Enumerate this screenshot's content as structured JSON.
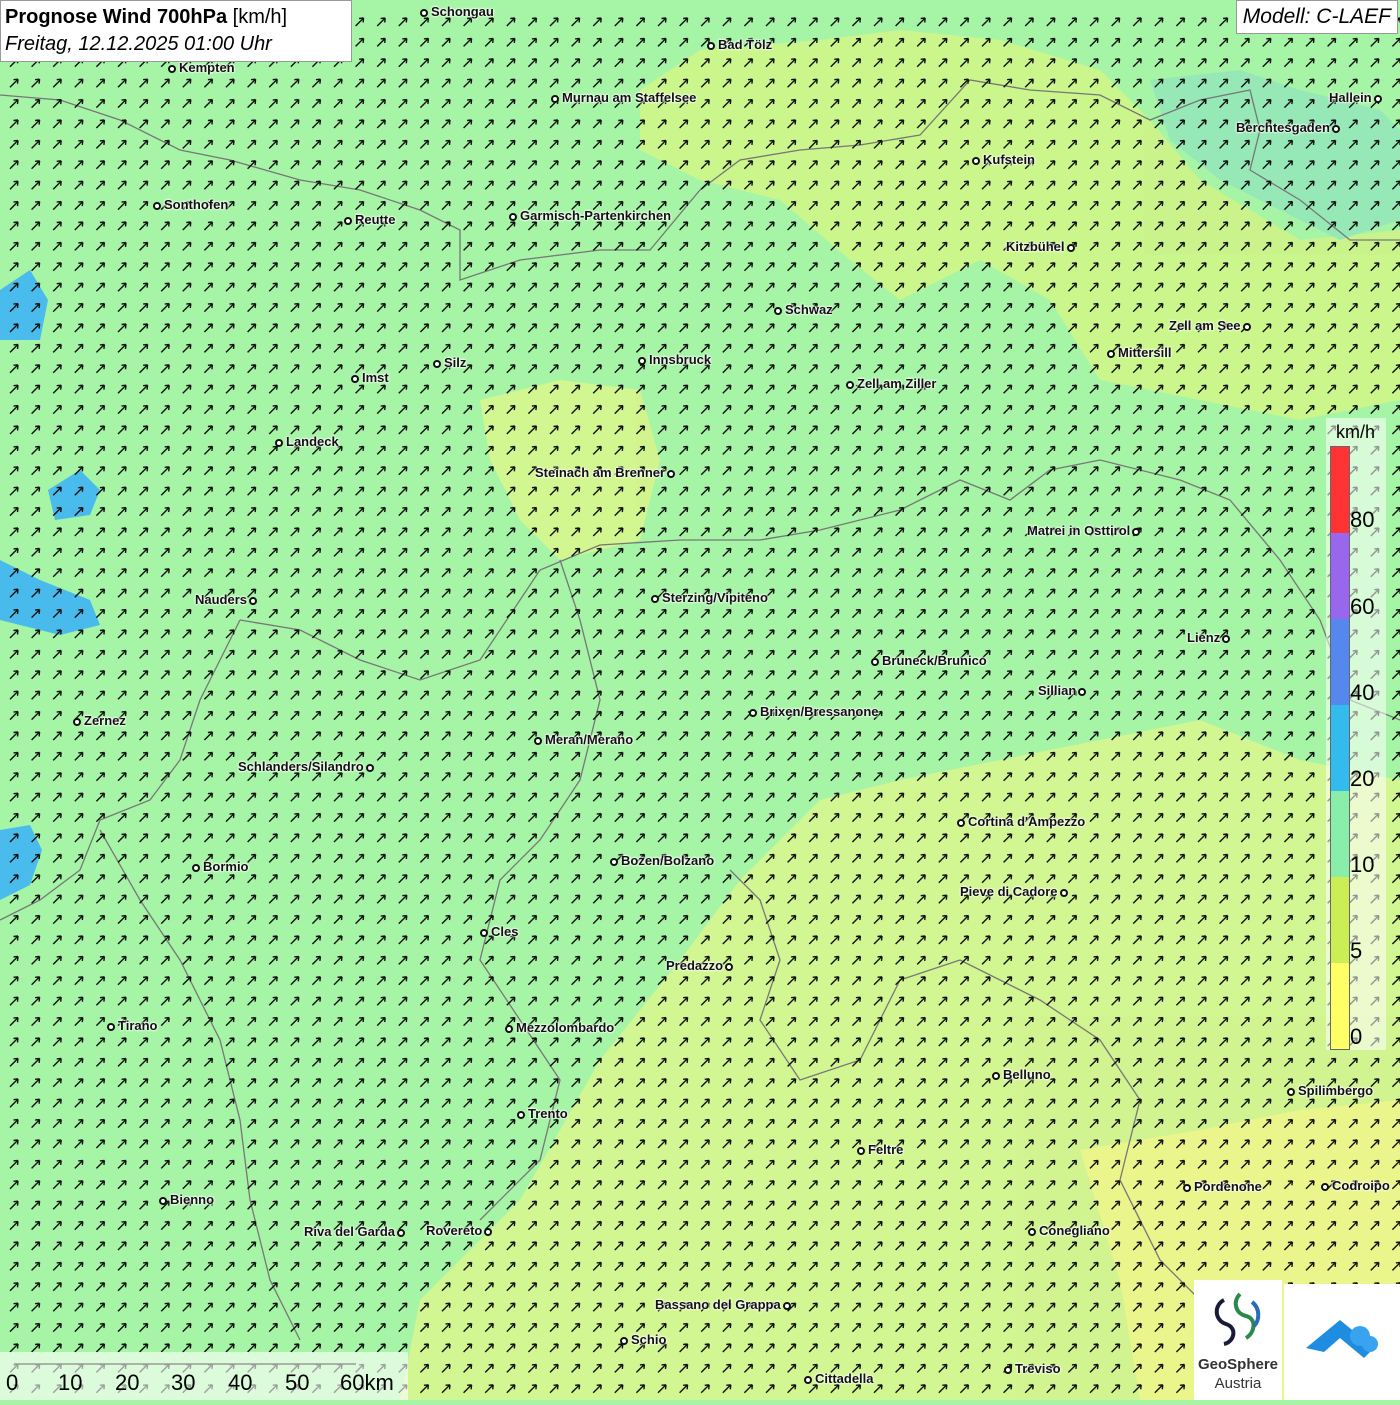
{
  "header": {
    "title_bold": "Prognose Wind 700hPa",
    "title_unit": "[km/h]",
    "subtitle": "Freitag, 12.12.2025 01:00 Uhr",
    "model": "Modell: C-LAEF"
  },
  "legend": {
    "unit": "km/h",
    "labels": [
      "80",
      "60",
      "40",
      "20",
      "10",
      "5",
      "0"
    ],
    "colors": [
      "#ff3333",
      "#9966ee",
      "#5588ee",
      "#33bbee",
      "#88eeaa",
      "#ccee55",
      "#ffff66"
    ]
  },
  "scale": {
    "labels": [
      "0",
      "10",
      "20",
      "30",
      "40",
      "50",
      "60km"
    ]
  },
  "logo": {
    "name_line1": "GeoSphere",
    "name_line2": "Austria"
  },
  "wind": {
    "arrow_direction": "north-east",
    "colors": {
      "base": "#a6f4a6",
      "mid": "#c6f59a",
      "yellow": "#e2f590",
      "blue": "#45b7f0"
    }
  },
  "cities": [
    {
      "name": "Schongau",
      "side": "r"
    },
    {
      "name": "Bad Tölz",
      "side": "r"
    },
    {
      "name": "Kempten",
      "side": "r"
    },
    {
      "name": "Murnau am Staffelsee",
      "side": "r"
    },
    {
      "name": "Hallein",
      "side": "l"
    },
    {
      "name": "Berchtesgaden",
      "side": "l"
    },
    {
      "name": "Kufstein",
      "side": "r"
    },
    {
      "name": "Sonthofen",
      "side": "r"
    },
    {
      "name": "Reutte",
      "side": "r"
    },
    {
      "name": "Garmisch-Partenkirchen",
      "side": "r"
    },
    {
      "name": "Kitzbühel",
      "side": "l"
    },
    {
      "name": "Schwaz",
      "side": "r"
    },
    {
      "name": "Zell am See",
      "side": "l"
    },
    {
      "name": "Innsbruck",
      "side": "r"
    },
    {
      "name": "Mittersill",
      "side": "r"
    },
    {
      "name": "Silz",
      "side": "r"
    },
    {
      "name": "Imst",
      "side": "r"
    },
    {
      "name": "Zell am Ziller",
      "side": "r"
    },
    {
      "name": "Landeck",
      "side": "r"
    },
    {
      "name": "Steinach am Brenner",
      "side": "l"
    },
    {
      "name": "Matrei in Osttirol",
      "side": "l"
    },
    {
      "name": "Nauders",
      "side": "l"
    },
    {
      "name": "Sterzing/Vipiteno",
      "side": "r"
    },
    {
      "name": "Lienz",
      "side": "l"
    },
    {
      "name": "Bruneck/Brunico",
      "side": "r"
    },
    {
      "name": "Sillian",
      "side": "l"
    },
    {
      "name": "Brixen/Bressanone",
      "side": "r"
    },
    {
      "name": "Zernez",
      "side": "r"
    },
    {
      "name": "Meran/Merano",
      "side": "r"
    },
    {
      "name": "Schlanders/Silandro",
      "side": "l"
    },
    {
      "name": "Cortina d'Ampezzo",
      "side": "r"
    },
    {
      "name": "Bozen/Bolzano",
      "side": "r"
    },
    {
      "name": "Bormio",
      "side": "r"
    },
    {
      "name": "Pieve di Cadore",
      "side": "l"
    },
    {
      "name": "Cles",
      "side": "r"
    },
    {
      "name": "Predazzo",
      "side": "l"
    },
    {
      "name": "Tirano",
      "side": "r"
    },
    {
      "name": "Mezzolombardo",
      "side": "r"
    },
    {
      "name": "Belluno",
      "side": "r"
    },
    {
      "name": "Spilimbergo",
      "side": "r"
    },
    {
      "name": "Trento",
      "side": "r"
    },
    {
      "name": "Feltre",
      "side": "r"
    },
    {
      "name": "Pordenone",
      "side": "r"
    },
    {
      "name": "Codroipo",
      "side": "r"
    },
    {
      "name": "Bienno",
      "side": "r"
    },
    {
      "name": "Riva del Garda",
      "side": "l"
    },
    {
      "name": "Rovereto",
      "side": "l"
    },
    {
      "name": "Conegliano",
      "side": "r"
    },
    {
      "name": "Bassano del Grappa",
      "side": "l"
    },
    {
      "name": "Schio",
      "side": "r"
    },
    {
      "name": "Treviso",
      "side": "r"
    },
    {
      "name": "Cittadella",
      "side": "r"
    }
  ]
}
